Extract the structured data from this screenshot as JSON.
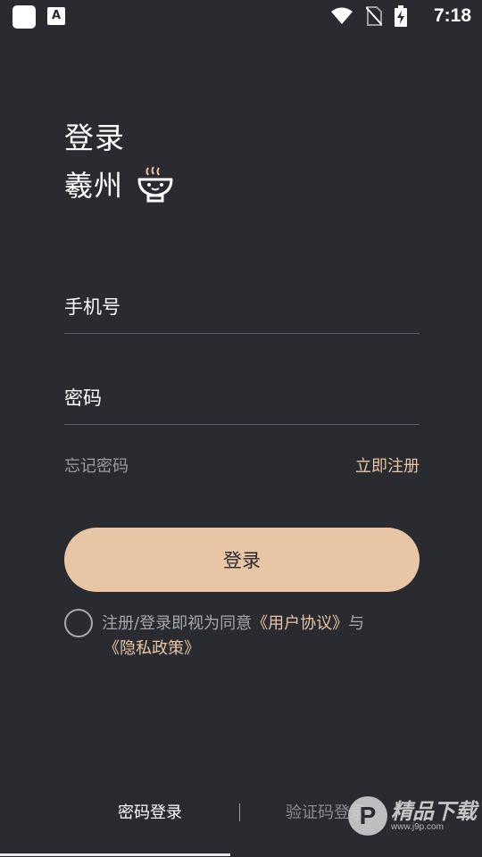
{
  "status_bar": {
    "time": "7:18",
    "notification_glyph": "A",
    "icons": [
      "wifi-icon",
      "no-sim-icon",
      "battery-charging-icon"
    ]
  },
  "login": {
    "title": "登录",
    "city": "羲州",
    "city_icon": "steaming-bowl-icon",
    "phone_label": "手机号",
    "password_label": "密码",
    "forgot_password": "忘记密码",
    "register_now": "立即注册",
    "login_button": "登录",
    "agreement_prefix": "注册/登录即视为同意",
    "user_agreement": "《用户协议》",
    "agreement_and": "与",
    "privacy_policy": "《隐私政策》"
  },
  "tabs": {
    "password_login": "密码登录",
    "code_login": "验证码登录"
  },
  "watermark": {
    "glyph": "P",
    "text": "精品下载",
    "sub": "www.j9p.com"
  },
  "colors": {
    "background": "#2a2b30",
    "accent": "#e8c6a5",
    "link": "#e7c5a4",
    "muted": "#9a9ba1"
  }
}
